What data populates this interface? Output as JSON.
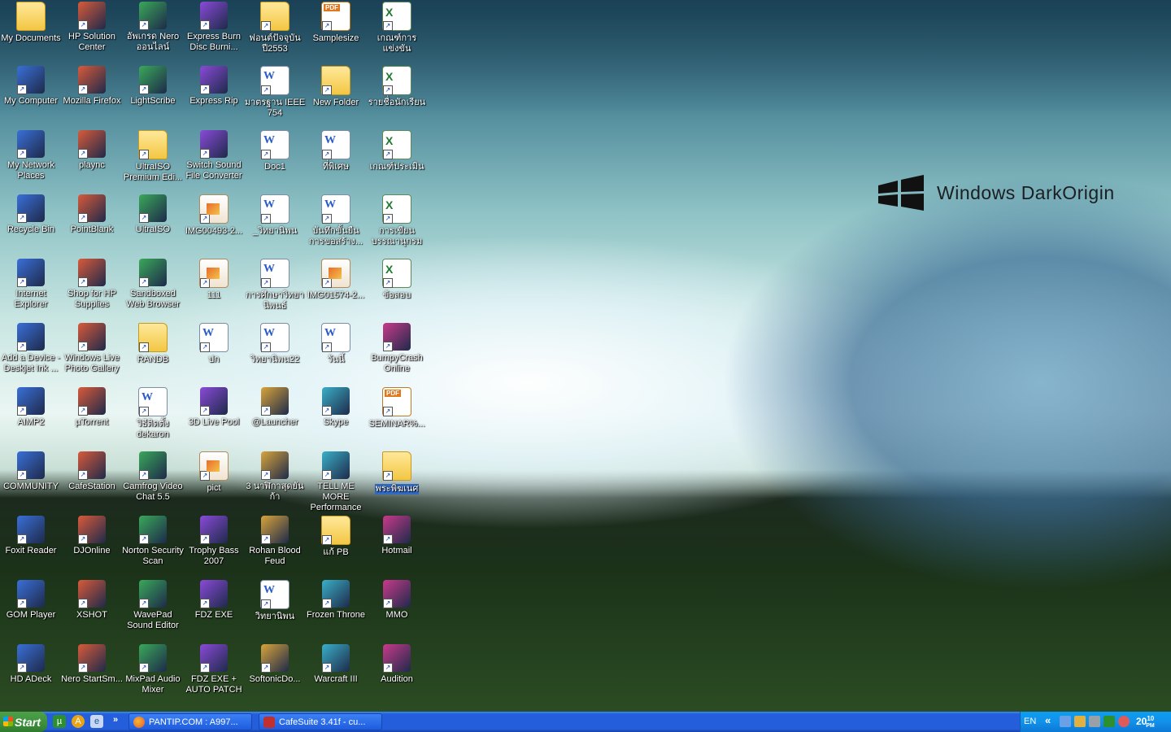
{
  "desktop": {
    "brand_text": "Windows DarkOrigin",
    "icons": [
      {
        "label": "My Documents",
        "icon": "my-documents-icon",
        "type": "folder"
      },
      {
        "label": "HP Solution Center",
        "icon": "hp-solution-center-icon",
        "type": "generic"
      },
      {
        "label": "อัพเกรด Nero ออนไลน์",
        "icon": "nero-upgrade-icon",
        "type": "generic"
      },
      {
        "label": "Express Burn Disc Burni...",
        "icon": "express-burn-icon",
        "type": "generic"
      },
      {
        "label": "ฟอนต์ปัจจุบัน ปี2553",
        "icon": "folder-icon",
        "type": "folder"
      },
      {
        "label": "Samplesize",
        "icon": "pdf-file-icon",
        "type": "pdf"
      },
      {
        "label": "เกณฑ์การแข่งขัน",
        "icon": "excel-file-icon",
        "type": "excel"
      },
      {
        "label": "My Computer",
        "icon": "my-computer-icon",
        "type": "generic"
      },
      {
        "label": "Mozilla Firefox",
        "icon": "firefox-icon",
        "type": "generic"
      },
      {
        "label": "LightScribe",
        "icon": "lightscribe-icon",
        "type": "generic"
      },
      {
        "label": "Express Rip",
        "icon": "express-rip-icon",
        "type": "generic"
      },
      {
        "label": "มาตรฐาน IEEE 754",
        "icon": "word-file-icon",
        "type": "word"
      },
      {
        "label": "New Folder",
        "icon": "folder-icon",
        "type": "folder"
      },
      {
        "label": "รายชื่อนักเรียน",
        "icon": "excel-file-icon",
        "type": "excel"
      },
      {
        "label": "My Network Places",
        "icon": "network-places-icon",
        "type": "generic"
      },
      {
        "label": "plaync",
        "icon": "plaync-icon",
        "type": "generic"
      },
      {
        "label": "UltraISO Premium Edi...",
        "icon": "folder-icon",
        "type": "folder"
      },
      {
        "label": "Switch Sound File Converter",
        "icon": "switch-sound-icon",
        "type": "generic"
      },
      {
        "label": "Doc1",
        "icon": "word-file-icon",
        "type": "word"
      },
      {
        "label": "ที่พิเศษ",
        "icon": "word-file-icon",
        "type": "word"
      },
      {
        "label": "เกณฑ์ประเมิน",
        "icon": "excel-file-icon",
        "type": "excel"
      },
      {
        "label": "Recycle Bin",
        "icon": "recycle-bin-icon",
        "type": "generic"
      },
      {
        "label": "PointBlank",
        "icon": "pointblank-icon",
        "type": "generic"
      },
      {
        "label": "UltraISO",
        "icon": "ultraiso-icon",
        "type": "generic"
      },
      {
        "label": "IMG00493-2...",
        "icon": "image-file-icon",
        "type": "img"
      },
      {
        "label": "_วิทยานิพน",
        "icon": "word-file-icon",
        "type": "word"
      },
      {
        "label": "บันทึกขั้นยืนการขอสร้าง...",
        "icon": "word-file-icon",
        "type": "word"
      },
      {
        "label": "การเขียนบรรณานุกรม",
        "icon": "excel-file-icon",
        "type": "excel"
      },
      {
        "label": "Internet Explorer",
        "icon": "internet-explorer-icon",
        "type": "generic"
      },
      {
        "label": "Shop for HP Supplies",
        "icon": "hp-shop-icon",
        "type": "generic"
      },
      {
        "label": "Sandboxed Web Browser",
        "icon": "sandboxed-browser-icon",
        "type": "generic"
      },
      {
        "label": "111",
        "icon": "image-file-icon",
        "type": "img"
      },
      {
        "label": "การศึกษาวิทยานิพนธ์",
        "icon": "word-file-icon",
        "type": "word"
      },
      {
        "label": "IMG01574-2...",
        "icon": "image-file-icon",
        "type": "img"
      },
      {
        "label": "ข้อสอบ",
        "icon": "excel-file-icon",
        "type": "excel"
      },
      {
        "label": "Add a Device - Deskjet Ink ...",
        "icon": "hp-device-icon",
        "type": "generic"
      },
      {
        "label": "Windows Live Photo Gallery",
        "icon": "photo-gallery-icon",
        "type": "generic"
      },
      {
        "label": "RANDB",
        "icon": "folder-icon",
        "type": "folder"
      },
      {
        "label": "ปก",
        "icon": "word-file-icon",
        "type": "word"
      },
      {
        "label": "วิทยานิพน22",
        "icon": "word-file-icon",
        "type": "word"
      },
      {
        "label": "วันนี้",
        "icon": "word-file-icon",
        "type": "word"
      },
      {
        "label": "BumpyCrash Online",
        "icon": "bumpycrash-icon",
        "type": "generic"
      },
      {
        "label": "AIMP2",
        "icon": "aimp-icon",
        "type": "generic"
      },
      {
        "label": "µTorrent",
        "icon": "utorrent-icon",
        "type": "generic"
      },
      {
        "label": "วิธีติดตั้ง dekaron",
        "icon": "word-file-icon",
        "type": "word"
      },
      {
        "label": "3D Live Pool",
        "icon": "pool-game-icon",
        "type": "generic"
      },
      {
        "label": "@Launcher",
        "icon": "launcher-icon",
        "type": "generic"
      },
      {
        "label": "Skype",
        "icon": "skype-icon",
        "type": "generic"
      },
      {
        "label": "SEMINAR%...",
        "icon": "pdf-file-icon",
        "type": "pdf"
      },
      {
        "label": "COMMUNITY",
        "icon": "internet-explorer-icon",
        "type": "generic"
      },
      {
        "label": "CafeStation",
        "icon": "cafestation-icon",
        "type": "generic"
      },
      {
        "label": "Camfrog Video Chat 5.5",
        "icon": "camfrog-icon",
        "type": "generic"
      },
      {
        "label": "pict",
        "icon": "image-file-icon",
        "type": "img"
      },
      {
        "label": "3 นาฬิกาสุดยัน ก้า",
        "icon": "game-icon",
        "type": "generic"
      },
      {
        "label": "TELL ME MORE Performance",
        "icon": "tell-me-more-icon",
        "type": "generic"
      },
      {
        "label": "พระพิฆเนศ",
        "icon": "folder-icon",
        "type": "folder",
        "selected": true
      },
      {
        "label": "Foxit Reader",
        "icon": "foxit-reader-icon",
        "type": "generic"
      },
      {
        "label": "DJOnline",
        "icon": "djonline-icon",
        "type": "generic"
      },
      {
        "label": "Norton Security Scan",
        "icon": "norton-icon",
        "type": "generic"
      },
      {
        "label": "Trophy Bass 2007",
        "icon": "trophy-bass-icon",
        "type": "generic"
      },
      {
        "label": "Rohan Blood Feud",
        "icon": "rohan-icon",
        "type": "generic"
      },
      {
        "label": "แก้ PB",
        "icon": "folder-icon",
        "type": "folder"
      },
      {
        "label": "Hotmail",
        "icon": "hotmail-icon",
        "type": "generic"
      },
      {
        "label": "GOM Player",
        "icon": "gom-player-icon",
        "type": "generic"
      },
      {
        "label": "XSHOT",
        "icon": "xshot-icon",
        "type": "generic"
      },
      {
        "label": "WavePad Sound Editor",
        "icon": "wavepad-icon",
        "type": "generic"
      },
      {
        "label": "FDZ EXE",
        "icon": "fdz-exe-icon",
        "type": "generic"
      },
      {
        "label": "วิทยานิพน",
        "icon": "word-file-icon",
        "type": "word"
      },
      {
        "label": "Frozen Throne",
        "icon": "frozen-throne-icon",
        "type": "generic"
      },
      {
        "label": "MMO",
        "icon": "mmo-icon",
        "type": "generic"
      },
      {
        "label": "HD ADeck",
        "icon": "hd-adeck-icon",
        "type": "generic"
      },
      {
        "label": "Nero StartSm...",
        "icon": "nero-icon",
        "type": "generic"
      },
      {
        "label": "MixPad Audio Mixer",
        "icon": "mixpad-icon",
        "type": "generic"
      },
      {
        "label": "FDZ EXE + AUTO PATCH",
        "icon": "fdz-patch-icon",
        "type": "generic"
      },
      {
        "label": "SoftonicDo...",
        "icon": "softonic-icon",
        "type": "generic"
      },
      {
        "label": "Warcraft III",
        "icon": "warcraft-icon",
        "type": "generic"
      },
      {
        "label": "Audition",
        "icon": "audition-icon",
        "type": "generic"
      }
    ]
  },
  "taskbar": {
    "start_label": "Start",
    "quick_launch": [
      "utorrent-icon",
      "aimp-icon",
      "cafestation-icon"
    ],
    "overflow_label": "»",
    "tasks": [
      {
        "label": "PANTIP.COM : A997...",
        "icon": "firefox-icon"
      },
      {
        "label": "CafeSuite 3.41f - cu...",
        "icon": "cafesuite-icon"
      }
    ],
    "tray": {
      "language": "EN",
      "expand_label": "«",
      "clock_time": "20",
      "clock_minutes": "10",
      "clock_ampm": "PM"
    }
  }
}
